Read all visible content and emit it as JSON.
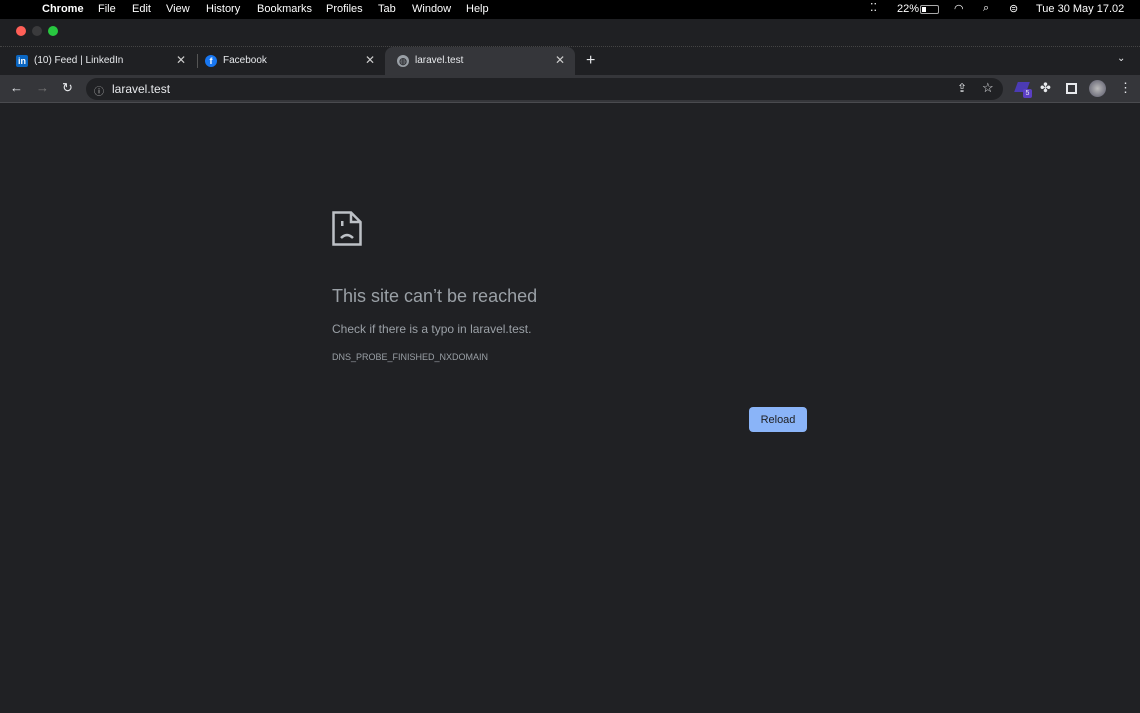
{
  "menubar": {
    "app": "Chrome",
    "items": [
      "File",
      "Edit",
      "View",
      "History",
      "Bookmarks",
      "Profiles",
      "Tab",
      "Window",
      "Help"
    ],
    "battery": "22%",
    "datetime": "Tue 30 May  17.02"
  },
  "tabs": [
    {
      "label": "(10) Feed | LinkedIn",
      "icon": "linkedin-icon",
      "active": false
    },
    {
      "label": "Facebook",
      "icon": "facebook-icon",
      "active": false
    },
    {
      "label": "laravel.test",
      "icon": "globe-icon",
      "active": true
    }
  ],
  "toolbar": {
    "url": "laravel.test",
    "extension_badge": "5"
  },
  "error": {
    "title": "This site can’t be reached",
    "description": "Check if there is a typo in laravel.test.",
    "code": "DNS_PROBE_FINISHED_NXDOMAIN",
    "reload_label": "Reload"
  },
  "colors": {
    "accent": "#8ab4f8",
    "background": "#202124"
  }
}
